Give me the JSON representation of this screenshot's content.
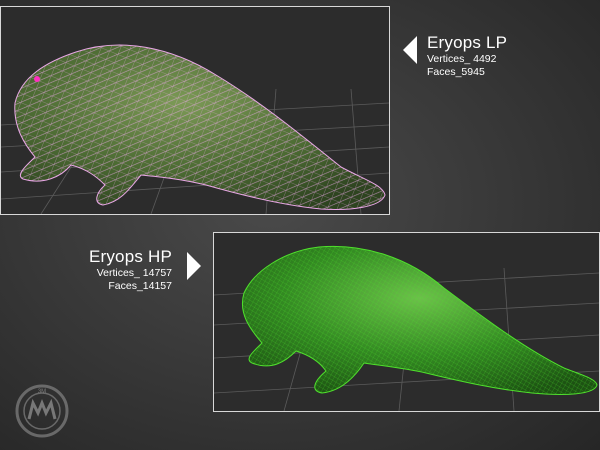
{
  "models": {
    "lp": {
      "name": "Eryops LP",
      "vertices": "Vertices_ 4492",
      "faces": "Faces_5945"
    },
    "hp": {
      "name": "Eryops HP",
      "vertices": "Vertices_ 14757",
      "faces": "Faces_14157"
    }
  },
  "icons": {
    "lp_pointer": "triangle-left-icon",
    "hp_pointer": "triangle-right-icon",
    "logo": "watermark-seal-logo"
  },
  "logo_text": "3M",
  "colors": {
    "lp_wire": "#e9a7e6",
    "lp_body": "#4d6e34",
    "hp_body": "#3f8f2a",
    "hp_wire": "#4fe02c",
    "viewport_bg": "#2c2c2c",
    "grid": "#5a5a5a"
  }
}
